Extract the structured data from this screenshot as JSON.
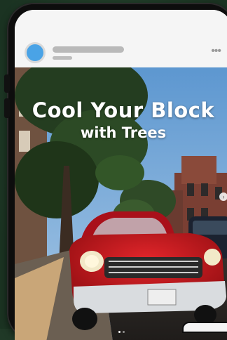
{
  "post": {
    "author_placeholder": "",
    "more_icon": "more-dots-icon",
    "more_glyph": "•••"
  },
  "image": {
    "headline_line1": "Cool Your Block",
    "headline_line2": "with Trees",
    "next_icon": "chevron-right-icon",
    "next_glyph": "›"
  },
  "colors": {
    "avatar": "#4aa3e6",
    "background": "#203927",
    "car": "#c8161a",
    "sky": "#6fa3d6"
  }
}
